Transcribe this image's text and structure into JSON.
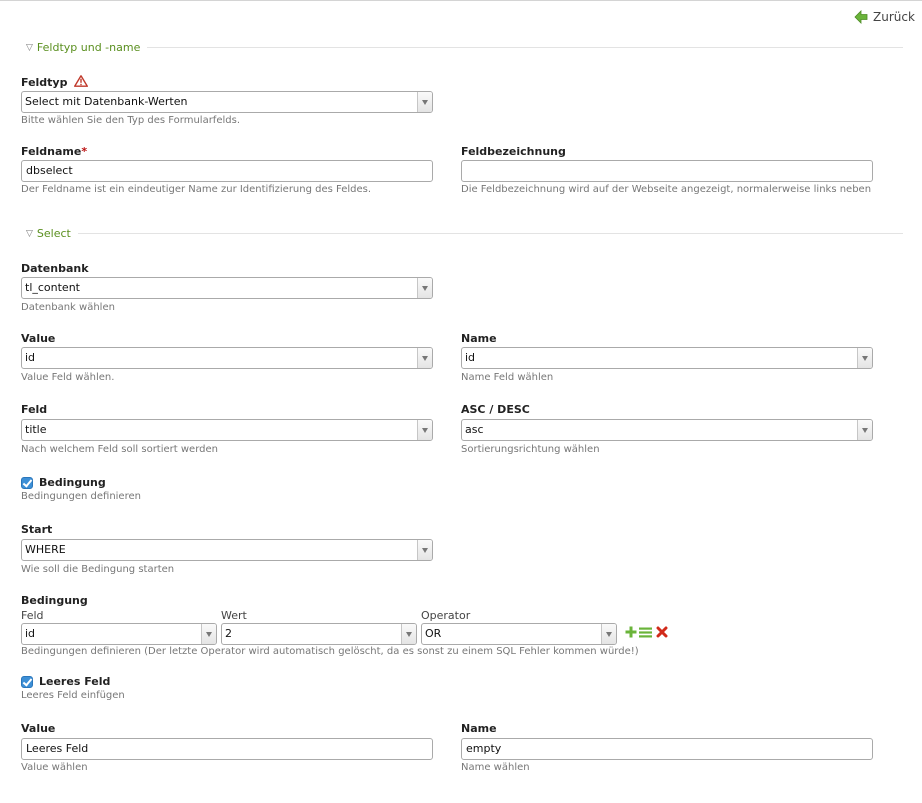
{
  "nav": {
    "back_label": "Zurück"
  },
  "sections": {
    "fieldtype": {
      "legend": "Feldtyp und -name"
    },
    "select": {
      "legend": "Select"
    }
  },
  "fields": {
    "feldtyp": {
      "label": "Feldtyp",
      "value": "Select mit Datenbank-Werten",
      "help": "Bitte wählen Sie den Typ des Formularfelds."
    },
    "feldname": {
      "label": "Feldname",
      "required_mark": "*",
      "value": "dbselect",
      "help": "Der Feldname ist ein eindeutiger Name zur Identifizierung des Feldes."
    },
    "feldbezeichnung": {
      "label": "Feldbezeichnung",
      "value": "",
      "help": "Die Feldbezeichnung wird auf der Webseite angezeigt, normalerweise links neben"
    },
    "datenbank": {
      "label": "Datenbank",
      "value": "tl_content",
      "help": "Datenbank wählen"
    },
    "value": {
      "label": "Value",
      "value": "id",
      "help": "Value Feld wählen."
    },
    "name": {
      "label": "Name",
      "value": "id",
      "help": "Name Feld wählen"
    },
    "feld": {
      "label": "Feld",
      "value": "title",
      "help": "Nach welchem Feld soll sortiert werden"
    },
    "order": {
      "label": "ASC / DESC",
      "value": "asc",
      "help": "Sortierungsrichtung wählen"
    },
    "bedingung_check": {
      "label": "Bedingung",
      "checked": true,
      "help": "Bedingungen definieren"
    },
    "start": {
      "label": "Start",
      "value": "WHERE",
      "help": "Wie soll die Bedingung starten"
    },
    "bedingung": {
      "label": "Bedingung",
      "col_feld": "Feld",
      "col_wert": "Wert",
      "col_operator": "Operator",
      "row": {
        "feld": "id",
        "wert": "2",
        "operator": "OR"
      },
      "help": "Bedingungen definieren (Der letzte Operator wird automatisch gelöscht, da es sonst zu einem SQL Fehler kommen würde!)"
    },
    "leeres_check": {
      "label": "Leeres Feld",
      "checked": true,
      "help": "Leeres Feld einfügen"
    },
    "empty_value": {
      "label": "Value",
      "value": "Leeres Feld",
      "help": "Value wählen"
    },
    "empty_name": {
      "label": "Name",
      "value": "empty",
      "help": "Name wählen"
    }
  },
  "colors": {
    "accent_green": "#5a8f1f",
    "checkbox_blue": "#3d8fd6",
    "required_red": "#b11111",
    "delete_red": "#d12a1a"
  }
}
